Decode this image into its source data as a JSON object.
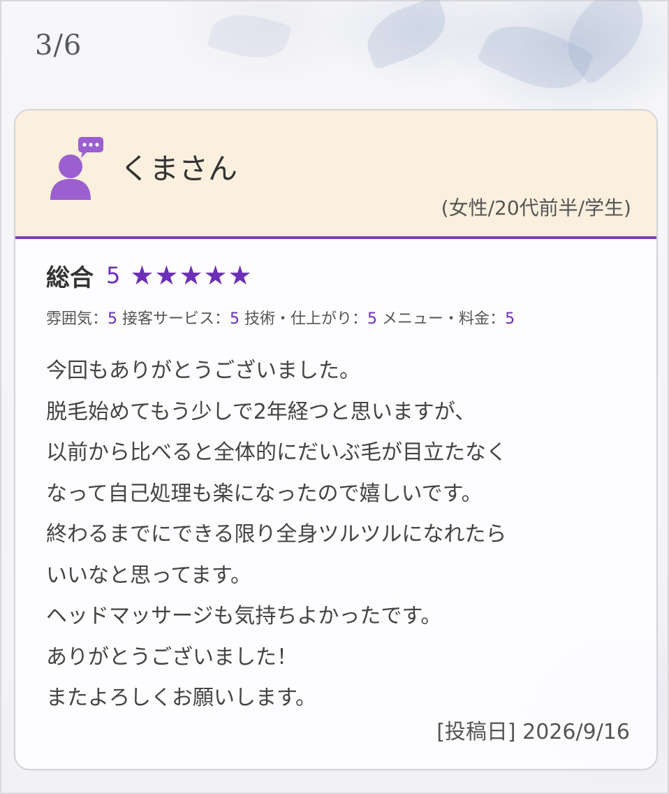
{
  "counter": "3/6",
  "reviewer": {
    "name": "くまさん",
    "meta": "(女性/20代前半/学生)"
  },
  "rating": {
    "overall_label": "総合",
    "overall_score": "5",
    "stars": "★★★★★",
    "star_value": 5,
    "star_max": 5,
    "categories": [
      {
        "label": "雰囲気：",
        "score": "5"
      },
      {
        "label": "接客サービス：",
        "score": "5"
      },
      {
        "label": "技術・仕上がり：",
        "score": "5"
      },
      {
        "label": "メニュー・料金：",
        "score": "5"
      }
    ]
  },
  "review": {
    "lines": [
      "今回もありがとうございました。",
      "脱毛始めてもう少しで2年経つと思いますが、",
      "以前から比べると全体的にだいぶ毛が目立たなく",
      "なって自己処理も楽になったので嬉しいです。",
      "終わるまでにできる限り全身ツルツルになれたら",
      "いいなと思ってます。",
      "ヘッドマッサージも気持ちよかったです。",
      "ありがとうございました！",
      "またよろしくお願いします。"
    ],
    "posted": "[投稿日] 2026/9/16"
  },
  "colors": {
    "accent": "#6c2fb8",
    "header_bg": "#fbf0de",
    "avatar": "#9b5fd0"
  },
  "icons": {
    "avatar": "user-comment-icon"
  }
}
